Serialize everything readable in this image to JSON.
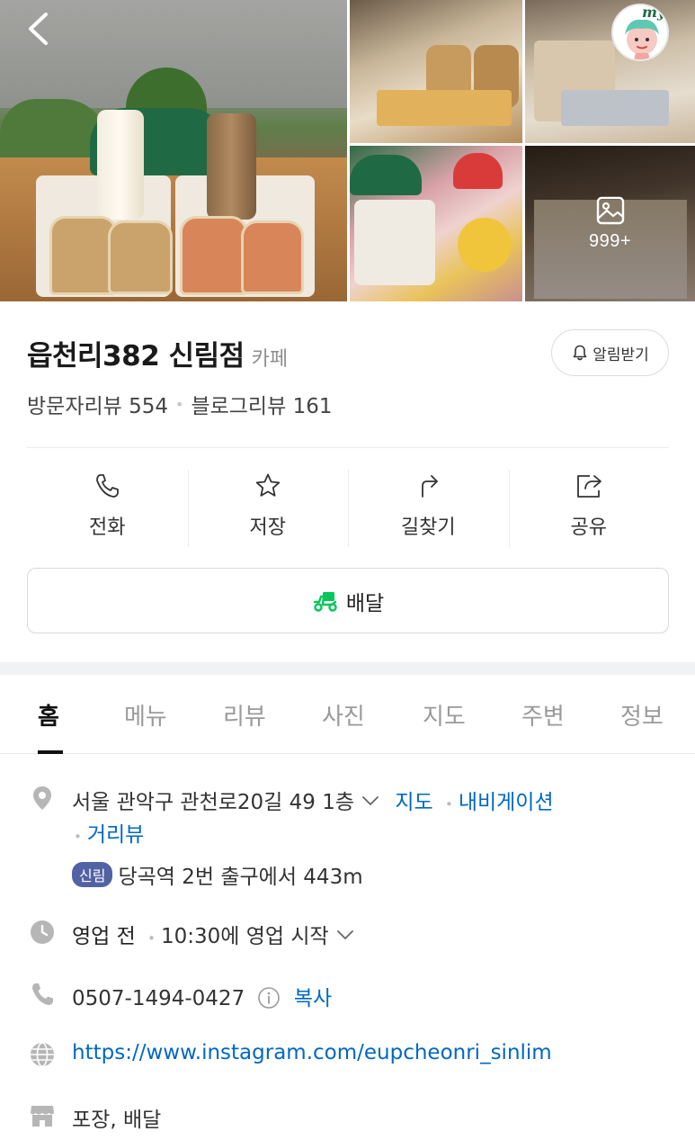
{
  "gallery": {
    "more_count": "999+",
    "photos": [
      "photo-main",
      "photo-top-middle",
      "photo-top-right",
      "photo-bottom-middle",
      "photo-bottom-right"
    ]
  },
  "my_badge": {
    "label": "my"
  },
  "place": {
    "name": "읍천리382 신림점",
    "category": "카페",
    "visitor_review": "방문자리뷰 554",
    "blog_review": "블로그리뷰 161",
    "alert_label": "알림받기"
  },
  "actions": [
    {
      "label": "전화",
      "icon": "phone-icon"
    },
    {
      "label": "저장",
      "icon": "star-icon"
    },
    {
      "label": "길찾기",
      "icon": "directions-icon"
    },
    {
      "label": "공유",
      "icon": "share-icon"
    }
  ],
  "delivery": {
    "label": "배달",
    "color": "#03c75a"
  },
  "tabs": [
    "홈",
    "메뉴",
    "리뷰",
    "사진",
    "지도",
    "주변",
    "정보"
  ],
  "info": {
    "address": "서울 관악구 관천로20길 49 1층",
    "map_link": "지도",
    "nav_link": "내비게이션",
    "street_view": "거리뷰",
    "subway_badge": "신림",
    "subway_text": "당곡역 2번 출구에서 443m",
    "status": "영업 전",
    "hours": "10:30에 영업 시작",
    "phone": "0507-1494-0427",
    "copy": "복사",
    "website": "https://www.instagram.com/eupcheonri_sinlim",
    "service": "포장, 배달"
  },
  "colors": {
    "link": "#0068c3",
    "subway": "#5362a4",
    "delivery_green": "#03c75a"
  }
}
